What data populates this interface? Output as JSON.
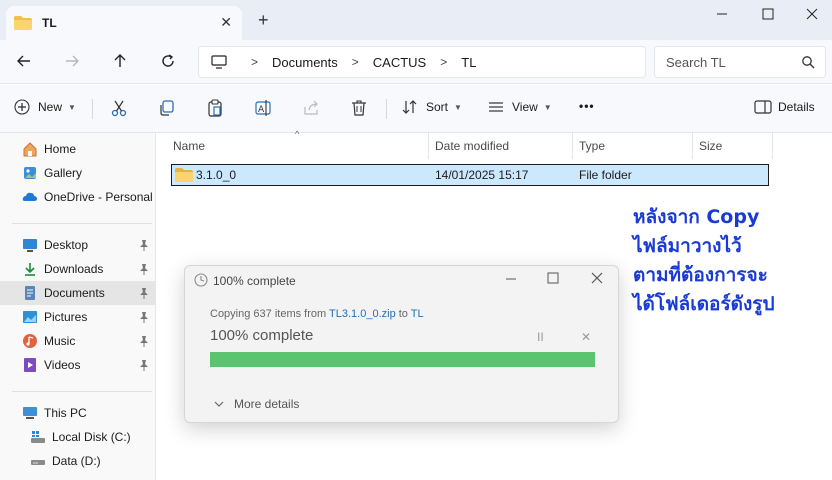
{
  "window": {
    "tab_title": "TL",
    "new_tab_symbol": "+"
  },
  "address": {
    "crumbs": [
      "Documents",
      "CACTUS",
      "TL"
    ],
    "search_placeholder": "Search TL"
  },
  "toolbar": {
    "new_label": "New",
    "sort_label": "Sort",
    "view_label": "View",
    "more_label": "•••",
    "details_label": "Details"
  },
  "sidebar": {
    "items": [
      {
        "label": "Home",
        "icon": "home-icon"
      },
      {
        "label": "Gallery",
        "icon": "gallery-icon"
      },
      {
        "label": "OneDrive - Personal",
        "icon": "cloud-icon"
      },
      {
        "label": "Desktop",
        "icon": "desktop-icon"
      },
      {
        "label": "Downloads",
        "icon": "download-icon"
      },
      {
        "label": "Documents",
        "icon": "documents-icon"
      },
      {
        "label": "Pictures",
        "icon": "pictures-icon"
      },
      {
        "label": "Music",
        "icon": "music-icon"
      },
      {
        "label": "Videos",
        "icon": "videos-icon"
      },
      {
        "label": "This PC",
        "icon": "pc-icon"
      },
      {
        "label": "Local Disk (C:)",
        "icon": "drive-icon"
      },
      {
        "label": "Data (D:)",
        "icon": "drive-icon"
      }
    ],
    "selected": "Documents"
  },
  "columns": [
    "Name",
    "Date modified",
    "Type",
    "Size"
  ],
  "files": [
    {
      "name": "3.1.0_0",
      "date": "14/01/2025 15:17",
      "type": "File folder",
      "size": ""
    }
  ],
  "annotation": {
    "text_lines": [
      "หลังจาก Copy",
      "ไฟล์มาวางไว้",
      "ตามที่ต้องการจะ",
      "ได้โฟล์เดอร์ดังรูป"
    ],
    "color": "#1a3ad6"
  },
  "copy_dialog": {
    "title": "100% complete",
    "sub_prefix": "Copying 637 items from ",
    "sub_source": "TL3.1.0_0.zip",
    "sub_mid": " to ",
    "sub_dest": "TL",
    "status": "100% complete",
    "pause_symbol": "II",
    "cancel_symbol": "✕",
    "progress_percent": 100,
    "progress_color": "#5cc46e",
    "more_details_label": "More details"
  }
}
